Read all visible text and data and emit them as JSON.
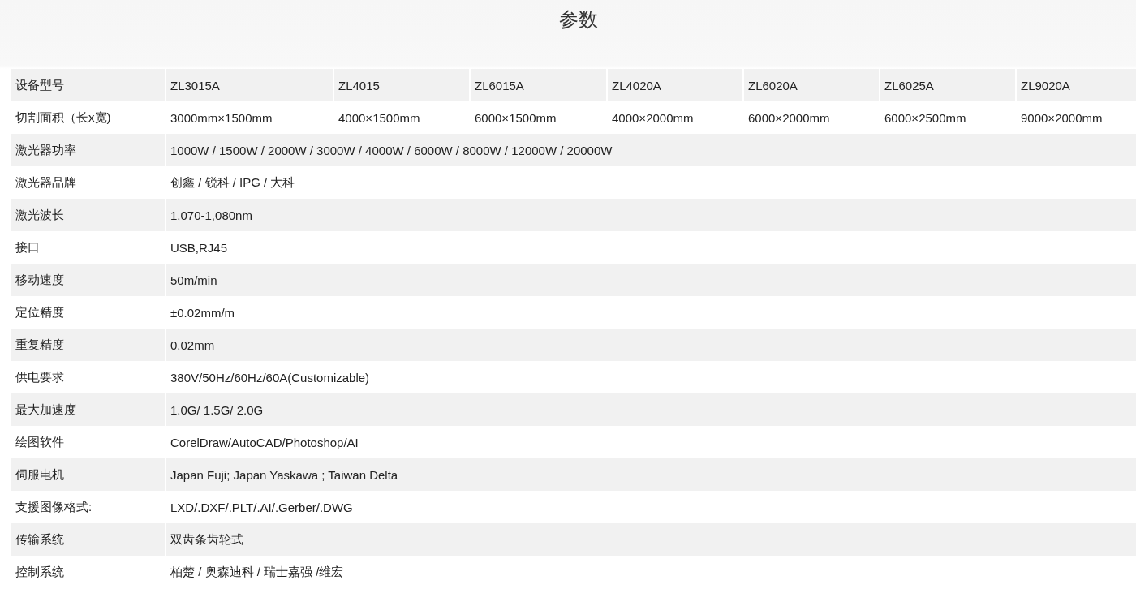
{
  "title": "参数",
  "table": {
    "rows": [
      {
        "label": "设备型号",
        "cells": [
          "ZL3015A",
          "ZL4015",
          "ZL6015A",
          "ZL4020A",
          "ZL6020A",
          "ZL6025A",
          "ZL9020A"
        ]
      },
      {
        "label": "切割面积（长x宽)",
        "cells": [
          "3000mm×1500mm",
          "4000×1500mm",
          "6000×1500mm",
          "4000×2000mm",
          "6000×2000mm",
          "6000×2500mm",
          "9000×2000mm"
        ]
      },
      {
        "label": "激光器功率",
        "cells": [
          "1000W / 1500W / 2000W / 3000W / 4000W / 6000W / 8000W / 12000W / 20000W"
        ]
      },
      {
        "label": "激光器品牌",
        "cells": [
          "创鑫 / 锐科 / IPG / 大科"
        ]
      },
      {
        "label": "激光波长",
        "cells": [
          "1,070-1,080nm"
        ]
      },
      {
        "label": "接口",
        "cells": [
          "USB,RJ45"
        ]
      },
      {
        "label": "移动速度",
        "cells": [
          "50m/min"
        ]
      },
      {
        "label": "定位精度",
        "cells": [
          "±0.02mm/m"
        ]
      },
      {
        "label": "重复精度",
        "cells": [
          "0.02mm"
        ]
      },
      {
        "label": "供电要求",
        "cells": [
          "380V/50Hz/60Hz/60A(Customizable)"
        ]
      },
      {
        "label": "最大加速度",
        "cells": [
          "1.0G/ 1.5G/ 2.0G"
        ]
      },
      {
        "label": "绘图软件",
        "cells": [
          "CorelDraw/AutoCAD/Photoshop/AI"
        ]
      },
      {
        "label": "伺服电机",
        "cells": [
          "Japan Fuji; Japan Yaskawa ; Taiwan Delta"
        ]
      },
      {
        "label": "支援图像格式:",
        "cells": [
          "LXD/.DXF/.PLT/.AI/.Gerber/.DWG"
        ]
      },
      {
        "label": "传输系统",
        "cells": [
          "双齿条齿轮式"
        ]
      },
      {
        "label": "控制系统",
        "cells": [
          "柏楚 / 奥森迪科 / 瑞士嘉强 /维宏"
        ]
      }
    ]
  }
}
